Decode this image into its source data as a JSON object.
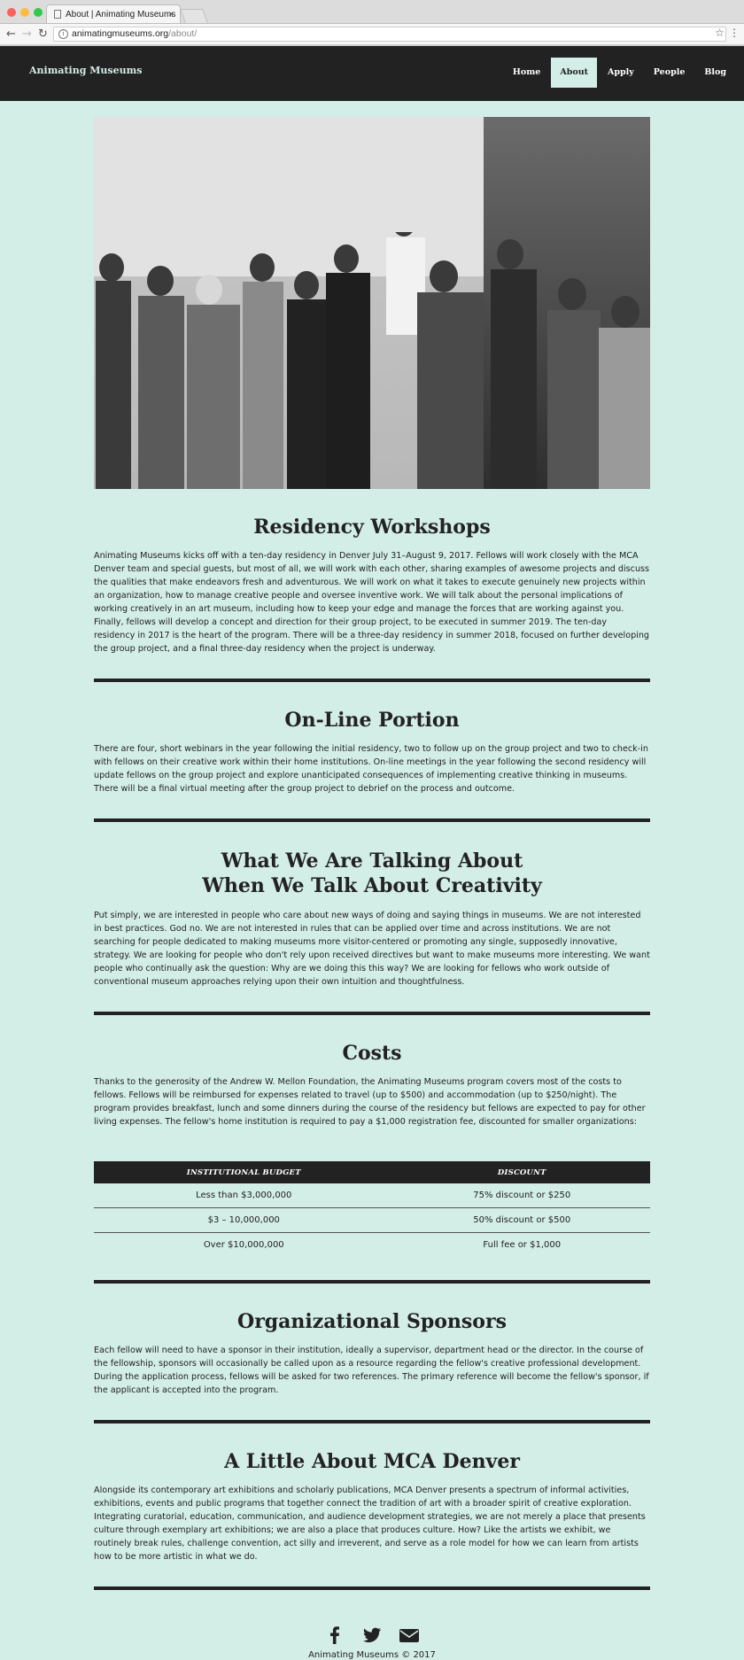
{
  "browser": {
    "tab_title": "About | Animating Museums",
    "tab_close": "×",
    "url_host": "animatingmuseums.org",
    "url_path": "/about/"
  },
  "site": {
    "brand": "Animating Museums",
    "nav": [
      "Home",
      "About",
      "Apply",
      "People",
      "Blog"
    ],
    "active_nav": "About"
  },
  "sections": [
    {
      "title": "Residency Workshops",
      "body": "Animating Museums kicks off with a ten-day residency in Denver July 31–August 9, 2017. Fellows will work closely with the MCA Denver team and special guests, but most of all, we will work with each other, sharing examples of awesome projects and discuss the qualities that make endeavors fresh and adventurous. We will work on what it takes to execute genuinely new projects within an organization, how to manage creative people and oversee inventive work. We will talk about the personal implications of working creatively in an art museum, including how to keep your edge and manage the forces that are working against you. Finally, fellows will develop a concept and direction for their group project, to be executed in summer 2019. The ten-day residency in 2017 is the heart of the program. There will be a three-day residency in summer 2018, focused on further developing the group project, and a final three-day residency when the project is underway."
    },
    {
      "title": "On-Line Portion",
      "body": "There are four, short webinars in the year following the initial residency, two to follow up on the group project and two to check-in with fellows on their creative work within their home institutions. On-line meetings in the year following the second residency will update fellows on the group project and explore unanticipated consequences of implementing creative thinking in museums. There will be a final virtual meeting after the group project to debrief on the process and outcome."
    },
    {
      "title_line1": "What We Are Talking About",
      "title_line2": "When We Talk About Creativity",
      "body": "Put simply, we are interested in people who care about new ways of doing and saying things in museums. We are not interested in best practices. God no. We are not interested in rules that can be applied over time and across institutions. We are not searching for people dedicated to making museums more visitor-centered or promoting any single, supposedly innovative, strategy. We are looking for people who don't rely upon received directives but want to make museums more interesting. We want people who continually ask the question: Why are we doing this this way? We are looking for fellows who work outside of conventional museum approaches relying upon their own intuition and thoughtfulness."
    },
    {
      "title": "Costs",
      "body": "Thanks to the generosity of the Andrew W. Mellon Foundation, the Animating Museums program covers most of the costs to fellows. Fellows will be reimbursed for expenses related to travel (up to $500) and accommodation (up to $250/night). The program provides breakfast, lunch and some dinners during the course of the residency but fellows are expected to pay for other living expenses. The fellow's home institution is required to pay a $1,000 registration fee, discounted for smaller organizations:",
      "table": {
        "headers": [
          "Institutional Budget",
          "Discount"
        ],
        "rows": [
          [
            "Less than $3,000,000",
            "75% discount or $250"
          ],
          [
            "$3 – 10,000,000",
            "50% discount or $500"
          ],
          [
            "Over $10,000,000",
            "Full fee or $1,000"
          ]
        ]
      }
    },
    {
      "title": "Organizational Sponsors",
      "body": "Each fellow will need to have a sponsor in their institution, ideally a supervisor, department head or the director. In the course of the fellowship, sponsors will occasionally be called upon as a resource regarding the fellow's creative professional development. During the application process, fellows will be asked for two references. The primary reference will become the fellow's sponsor, if the applicant is accepted into the program."
    },
    {
      "title": "A Little About MCA Denver",
      "body": "Alongside its contemporary art exhibitions and scholarly publications, MCA Denver presents a spectrum of informal activities, exhibitions, events and public programs that together connect the tradition of art with a broader spirit of creative exploration. Integrating curatorial, education, communication, and audience development strategies, we are not merely a place that presents culture through exemplary art exhibitions; we are also a place that produces culture. How? Like the artists we exhibit, we routinely break rules, challenge convention, act silly and irreverent, and serve as a role model for how we can learn from artists how to be more artistic in what we do."
    }
  ],
  "footer": {
    "icons": [
      "facebook-icon",
      "twitter-icon",
      "email-icon"
    ],
    "copyright": "Animating Museums © 2017"
  },
  "colors": {
    "background": "#d3ede7",
    "header": "#222222",
    "accent": "#d3ede7"
  }
}
